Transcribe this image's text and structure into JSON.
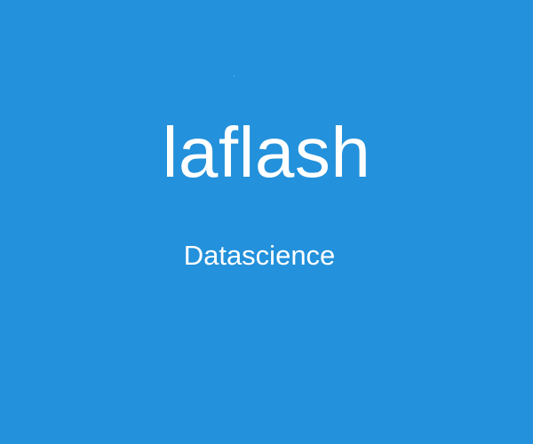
{
  "title": "laflash",
  "subtitle": "Datascience",
  "colors": {
    "background": "#2391db",
    "text": "#ffffff"
  }
}
